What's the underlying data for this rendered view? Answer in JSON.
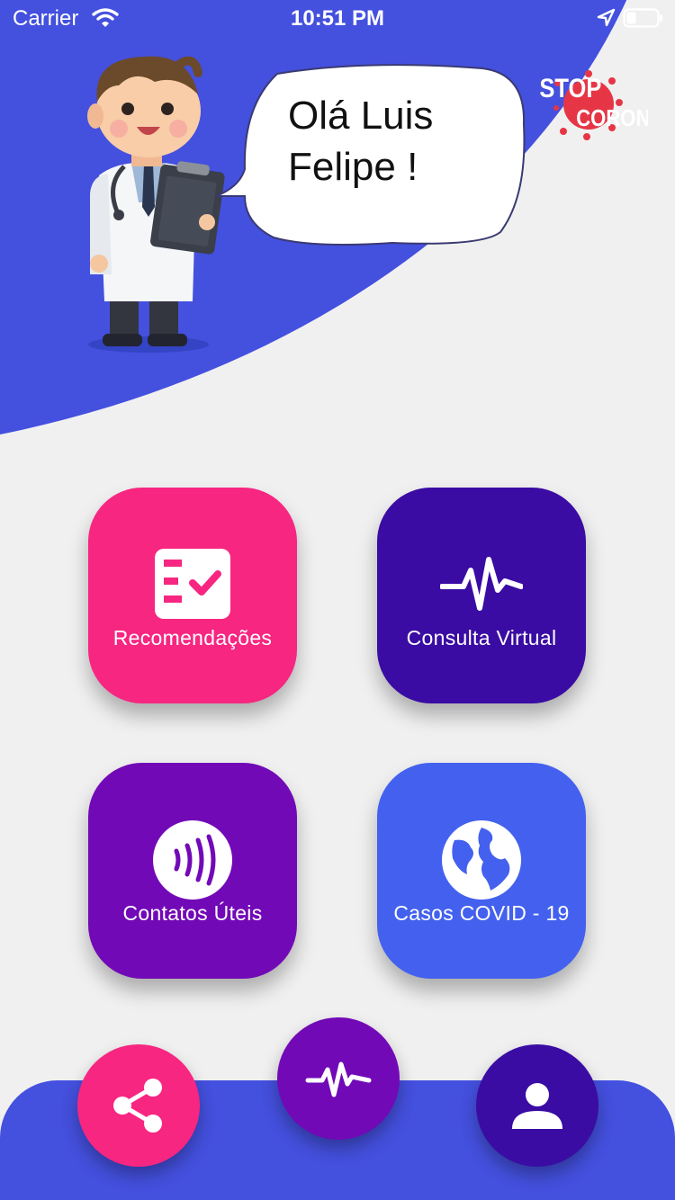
{
  "status_bar": {
    "carrier": "Carrier",
    "time": "10:51 PM"
  },
  "header": {
    "greeting": "Olá Luis Felipe !",
    "logo_top": "STOP",
    "logo_bottom": "CORONA"
  },
  "tiles": [
    {
      "label": "Recomendações",
      "icon": "checklist-icon",
      "color": "#f72681"
    },
    {
      "label": "Consulta Virtual",
      "icon": "heartbeat-icon",
      "color": "#3a0ca3"
    },
    {
      "label": "Contatos Úteis",
      "icon": "contactless-icon",
      "color": "#7209b7"
    },
    {
      "label": "Casos COVID - 19",
      "icon": "globe-icon",
      "color": "#4361ee"
    }
  ],
  "bottom_nav": {
    "buttons": [
      {
        "icon": "share-icon",
        "color": "#f72681"
      },
      {
        "icon": "heartbeat-icon",
        "color": "#7209b7"
      },
      {
        "icon": "person-icon",
        "color": "#3a0ca3"
      }
    ]
  },
  "colors": {
    "header_blue": "#4450de",
    "background": "#f0f0f0"
  }
}
